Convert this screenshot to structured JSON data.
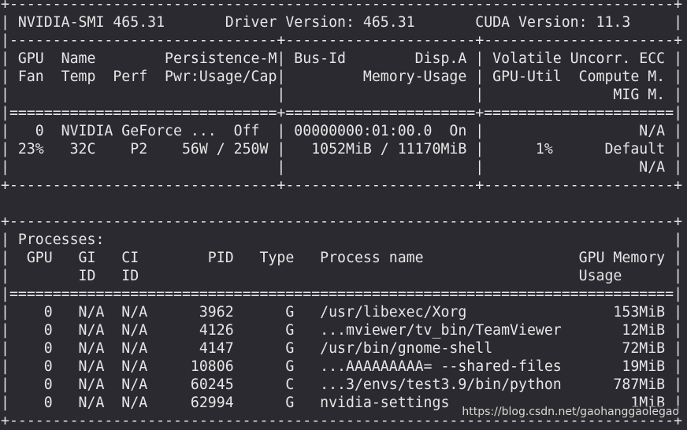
{
  "terminal": {
    "lines": [
      "+-----------------------------------------------------------------------------+",
      "| NVIDIA-SMI 465.31       Driver Version: 465.31       CUDA Version: 11.3     |",
      "|-------------------------------+----------------------+----------------------+",
      "| GPU  Name        Persistence-M| Bus-Id        Disp.A | Volatile Uncorr. ECC |",
      "| Fan  Temp  Perf  Pwr:Usage/Cap|         Memory-Usage | GPU-Util  Compute M. |",
      "|                               |                      |               MIG M. |",
      "|===============================+======================+======================|",
      "|   0  NVIDIA GeForce ...  Off  | 00000000:01:00.0  On |                  N/A |",
      "| 23%   32C    P2    56W / 250W |   1052MiB / 11170MiB |      1%      Default |",
      "|                               |                      |                  N/A |",
      "+-------------------------------+----------------------+----------------------+",
      "",
      "+-----------------------------------------------------------------------------+",
      "| Processes:                                                                  |",
      "|  GPU   GI   CI        PID   Type   Process name                  GPU Memory |",
      "|        ID   ID                                                   Usage      |",
      "|=============================================================================|",
      "|    0   N/A  N/A      3962      G   /usr/libexec/Xorg                 153MiB |",
      "|    0   N/A  N/A      4126      G   ...mviewer/tv_bin/TeamViewer       12MiB |",
      "|    0   N/A  N/A      4147      G   /usr/bin/gnome-shell               72MiB |",
      "|    0   N/A  N/A     10806      G   ...AAAAAAAAA= --shared-files       19MiB |",
      "|    0   N/A  N/A     60245      C   ...3/envs/test3.9/bin/python      787MiB |",
      "|    0   N/A  N/A     62994      G   nvidia-settings                     1MiB |",
      "+-----------------------------------------------------------------------------+"
    ]
  },
  "watermark": {
    "text": "https://blog.csdn.net/gaohanggaolegao"
  },
  "colors": {
    "background": "#2a2a30",
    "foreground": "#e6e6e6"
  }
}
